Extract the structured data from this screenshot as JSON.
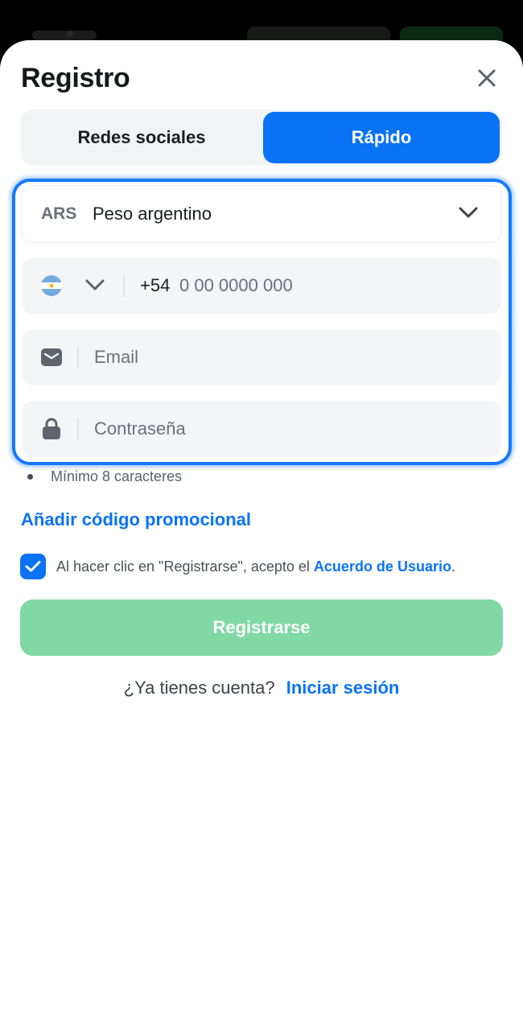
{
  "header": {
    "title": "Registro"
  },
  "tabs": [
    {
      "label": "Redes sociales",
      "active": false
    },
    {
      "label": "Rápido",
      "active": true
    }
  ],
  "currency": {
    "code": "ARS",
    "name": "Peso argentino"
  },
  "phone": {
    "country_flag": "argentina-flag-icon",
    "prefix": "+54",
    "placeholder": "0 00 0000 000"
  },
  "email": {
    "placeholder": "Email"
  },
  "password": {
    "placeholder": "Contraseña",
    "hint": "Mínimo 8 caracteres"
  },
  "promo": {
    "label": "Añadir código promocional"
  },
  "agreement": {
    "checked": true,
    "text": "Al hacer clic en \"Registrarse\", acepto el ",
    "link": "Acuerdo de Usuario",
    "suffix": "."
  },
  "register_button": {
    "label": "Registrarse"
  },
  "login": {
    "prompt": "¿Ya tienes cuenta?",
    "link": "Iniciar sesión"
  },
  "colors": {
    "accent": "#0a73f5",
    "register_disabled": "#80d9a4",
    "focus_ring": "#1478ff"
  }
}
